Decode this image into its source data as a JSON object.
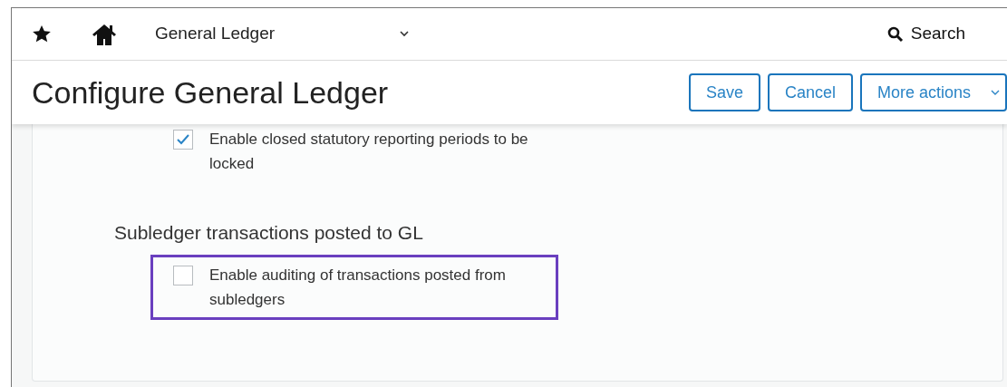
{
  "nav": {
    "module": "General Ledger",
    "search": "Search"
  },
  "header": {
    "title": "Configure General Ledger",
    "buttons": [
      "Save",
      "Cancel",
      "More actions"
    ]
  },
  "sections": [
    {
      "options": [
        {
          "label": "Enable closed statutory reporting periods to be locked",
          "checked": true,
          "highlighted": false
        }
      ]
    },
    {
      "heading": "Subledger transactions posted to GL",
      "options": [
        {
          "label": "Enable auditing of transactions posted from subledgers",
          "checked": false,
          "highlighted": true
        }
      ]
    }
  ]
}
